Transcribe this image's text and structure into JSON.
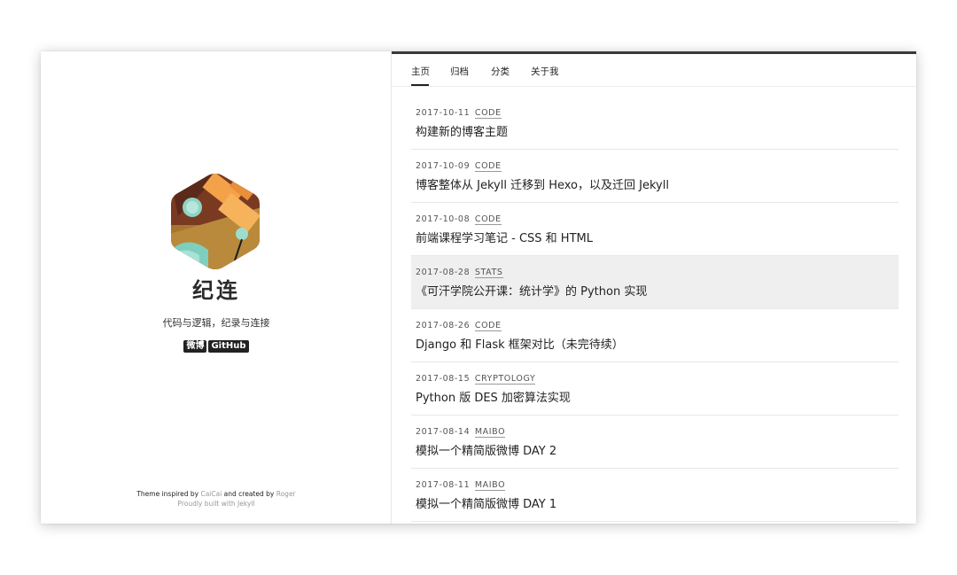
{
  "site": {
    "title": "纪连",
    "description": "代码与逻辑，纪录与连接",
    "social": [
      {
        "label": "微博"
      },
      {
        "label": "GitHub"
      }
    ],
    "footer": {
      "line1_prefix": "Theme inspired by ",
      "inspired_name": "CaiCai",
      "line1_middle": " and created by ",
      "creator_name": "Roger",
      "line2": "Proudly built with Jekyll"
    }
  },
  "nav": {
    "items": [
      {
        "label": "主页",
        "active": true
      },
      {
        "label": "归档",
        "active": false
      },
      {
        "label": "分类",
        "active": false
      },
      {
        "label": "关于我",
        "active": false
      }
    ]
  },
  "posts": [
    {
      "date": "2017-10-11",
      "category": "CODE",
      "title": "构建新的博客主题"
    },
    {
      "date": "2017-10-09",
      "category": "CODE",
      "title": "博客整体从 Jekyll 迁移到 Hexo，以及迁回 Jekyll"
    },
    {
      "date": "2017-10-08",
      "category": "CODE",
      "title": "前端课程学习笔记 - CSS 和 HTML"
    },
    {
      "date": "2017-08-28",
      "category": "STATS",
      "title": "《可汗学院公开课：统计学》的 Python 实现"
    },
    {
      "date": "2017-08-26",
      "category": "CODE",
      "title": "Django 和 Flask 框架对比（未完待续）"
    },
    {
      "date": "2017-08-15",
      "category": "CRYPTOLOGY",
      "title": "Python 版 DES 加密算法实现"
    },
    {
      "date": "2017-08-14",
      "category": "MAIBO",
      "title": "模拟一个精简版微博 DAY 2"
    },
    {
      "date": "2017-08-11",
      "category": "MAIBO",
      "title": "模拟一个精简版微博 DAY 1"
    }
  ],
  "colors": {
    "text": "#222222",
    "highlight_row": "#efefef",
    "nav_top_border": "#3a3a3a",
    "badge": "#222222"
  }
}
